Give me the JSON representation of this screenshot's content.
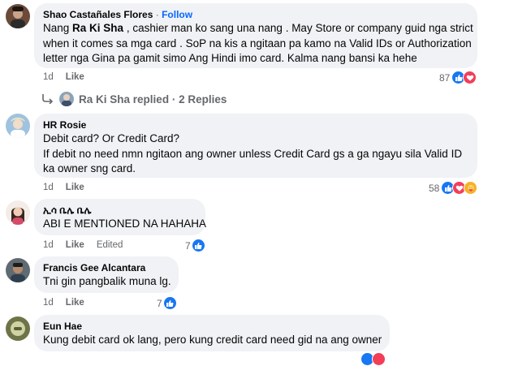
{
  "comments": [
    {
      "author": "Shao Castañales Flores",
      "follow": "Follow",
      "text_lines": [
        {
          "pre": "Nang ",
          "bold": "Ra Ki Sha",
          "post": " , cashier man ko sang una nang . May Store or company guid nga strict"
        },
        {
          "pre": "when it comes sa mga card . SoP na kis a ngitaan pa kamo na Valid IDs or Authorization",
          "bold": "",
          "post": ""
        },
        {
          "pre": "letter nga Gina pa gamit simo Ang Hindi imo card. Kalma nang bansi ka hehe",
          "bold": "",
          "post": ""
        }
      ],
      "time": "1d",
      "like": "Like",
      "reaction_count": "87",
      "reactions": [
        "like",
        "love"
      ]
    },
    {
      "author": "HR Rosie",
      "text": [
        "Debit card? Or Credit Card?",
        "If debit no need nmn ngitaon ang owner unless Credit Card gs a ga ngayu sila Valid ID",
        "ka owner sng card."
      ],
      "time": "1d",
      "like": "Like",
      "reaction_count": "58",
      "reactions": [
        "like",
        "love",
        "care"
      ]
    },
    {
      "author": "ኢሳ ቤሌ ቤሌ",
      "text": [
        "ABI E MENTIONED NA HAHAHA"
      ],
      "time": "1d",
      "like": "Like",
      "edited": "Edited",
      "reaction_count": "7",
      "reactions": [
        "like"
      ]
    },
    {
      "author": "Francis Gee Alcantara",
      "text": [
        "Tni gin pangbalik muna lg."
      ],
      "time": "1d",
      "like": "Like",
      "reaction_count": "7",
      "reactions": [
        "like"
      ]
    },
    {
      "author": "Eun Hae",
      "text": [
        "Kung debit card ok lang, pero kung credit card need gid na ang owner"
      ]
    }
  ],
  "replies": {
    "author": "Ra Ki Sha",
    "label": "replied",
    "separator": "·",
    "count": "2 Replies"
  },
  "colors": {
    "bubble": "#f0f2f5",
    "meta": "#65676b",
    "follow": "#0866ff",
    "like_reaction": "#1877f2",
    "love_reaction": "#f33e58",
    "care_reaction": "#f7b125"
  }
}
